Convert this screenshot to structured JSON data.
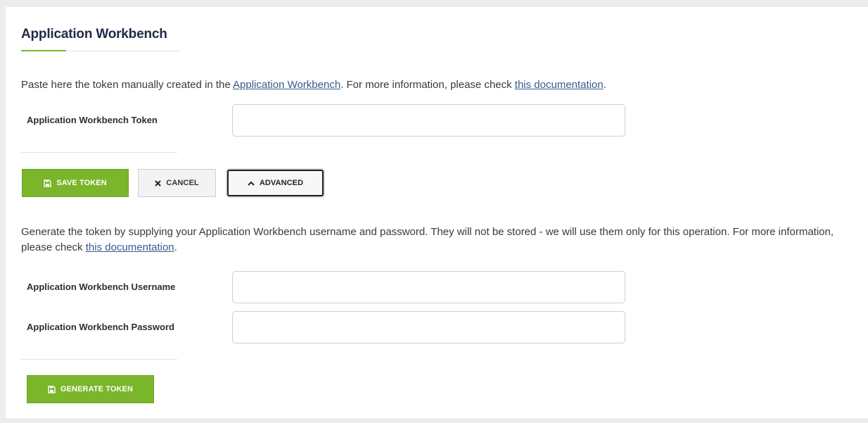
{
  "section": {
    "title": "Application Workbench"
  },
  "token_section": {
    "intro_prefix": "Paste here the token manually created in the ",
    "intro_link1": "Application Workbench",
    "intro_middle": ". For more information, please check ",
    "intro_link2": "this documentation",
    "intro_suffix": ".",
    "token_label": "Application Workbench Token",
    "token_value": "",
    "save_label": "SAVE TOKEN",
    "cancel_label": "CANCEL",
    "advanced_label": "ADVANCED"
  },
  "advanced_section": {
    "intro_prefix": "Generate the token by supplying your Application Workbench username and password. They will not be stored - we will use them only for this operation. For more information, please check ",
    "intro_link": "this documentation",
    "intro_suffix": ".",
    "username_label": "Application Workbench Username",
    "username_value": "",
    "password_label": "Application Workbench Password",
    "password_value": "",
    "generate_label": "GENERATE TOKEN"
  },
  "icons": {
    "save": "save-icon",
    "cancel": "close-icon",
    "advanced": "chevron-up-icon",
    "generate": "save-icon"
  },
  "colors": {
    "accent_green": "#7ab52a",
    "title": "#232b47",
    "link": "#3a5a8c"
  }
}
